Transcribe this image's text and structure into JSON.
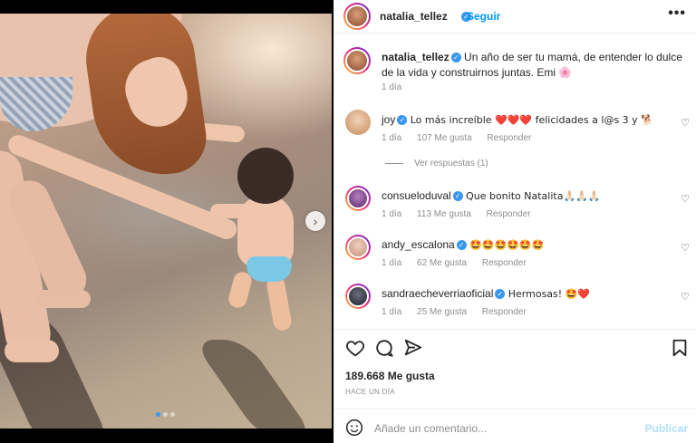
{
  "post": {
    "author": "natalia_tellez",
    "follow_separator": "•",
    "follow_label": "Seguir",
    "more_label": "•••",
    "caption_text": "Un año de ser tu mamá, de entender lo dulce de la vida y construirnos juntas. Emi 🌸",
    "caption_time": "1 día",
    "likes": "189.668 Me gusta",
    "time_ago": "HACE UN DÍA"
  },
  "comments": [
    {
      "user": "joy",
      "text": "Lo más increíble ❤️❤️❤️ felicidades a l@s 3 y 🐕",
      "time": "1 día",
      "likes": "107 Me gusta",
      "reply": "Responder"
    },
    {
      "user": "consueloduval",
      "text": "Que bonito Natalita🙏🏻🙏🏻🙏🏻",
      "time": "1 día",
      "likes": "113 Me gusta",
      "reply": "Responder"
    },
    {
      "user": "andy_escalona",
      "text": "🤩🤩🤩🤩🤩🤩",
      "time": "1 día",
      "likes": "62 Me gusta",
      "reply": "Responder"
    },
    {
      "user": "sandraecheverriaoficial",
      "text": "Hermosas! 🤩❤️",
      "time": "1 día",
      "likes": "25 Me gusta",
      "reply": "Responder"
    }
  ],
  "replies": {
    "label": "Ver respuestas (1)"
  },
  "add_comment": {
    "placeholder": "Añade un comentario...",
    "publish": "Publicar"
  },
  "icons": {
    "like": "heart-icon",
    "comment": "comment-icon",
    "share": "send-icon",
    "save": "bookmark-icon",
    "emoji": "emoji-icon",
    "next": "chevron-right-icon"
  },
  "colors": {
    "link": "#0095f6",
    "verified": "#3897f0",
    "publish_disabled": "#b2dffc"
  }
}
